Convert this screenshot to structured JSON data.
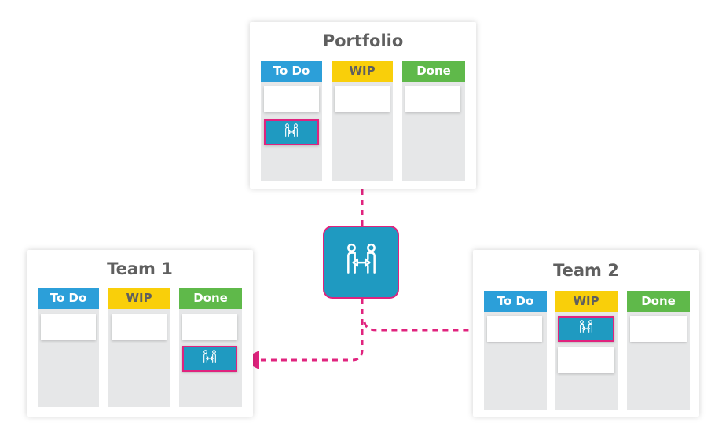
{
  "boards": [
    {
      "title": "Portfolio",
      "columns": [
        "To Do",
        "WIP",
        "Done"
      ]
    },
    {
      "title": "Team 1",
      "columns": [
        "To Do",
        "WIP",
        "Done"
      ]
    },
    {
      "title": "Team 2",
      "columns": [
        "To Do",
        "WIP",
        "Done"
      ]
    }
  ],
  "icons": {
    "dependency": "people-exchange-icon"
  },
  "colors": {
    "todo": "#2c9fd9",
    "wip": "#f9cf0a",
    "done": "#5fb94a",
    "link": "#e0237e",
    "card": "#1f9ac1"
  }
}
